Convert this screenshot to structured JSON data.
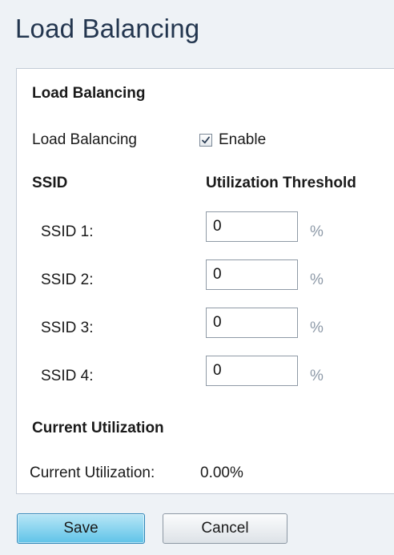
{
  "page_title": "Load Balancing",
  "panel": {
    "section_title": "Load Balancing",
    "load_balancing": {
      "label": "Load Balancing",
      "checkbox_checked": true,
      "checkbox_label": "Enable"
    },
    "table_headers": {
      "ssid": "SSID",
      "threshold": "Utilization Threshold"
    },
    "rows": [
      {
        "label": "SSID 1:",
        "value": "0",
        "unit": "%"
      },
      {
        "label": "SSID 2:",
        "value": "0",
        "unit": "%"
      },
      {
        "label": "SSID 3:",
        "value": "0",
        "unit": "%"
      },
      {
        "label": "SSID 4:",
        "value": "0",
        "unit": "%"
      }
    ],
    "current_utilization": {
      "section_title": "Current Utilization",
      "label": "Current Utilization:",
      "value": "0.00%"
    }
  },
  "footer": {
    "save_label": "Save",
    "cancel_label": "Cancel"
  },
  "colors": {
    "title": "#23364f",
    "save_button": "#5fc3e8",
    "background": "#eef2f6"
  }
}
